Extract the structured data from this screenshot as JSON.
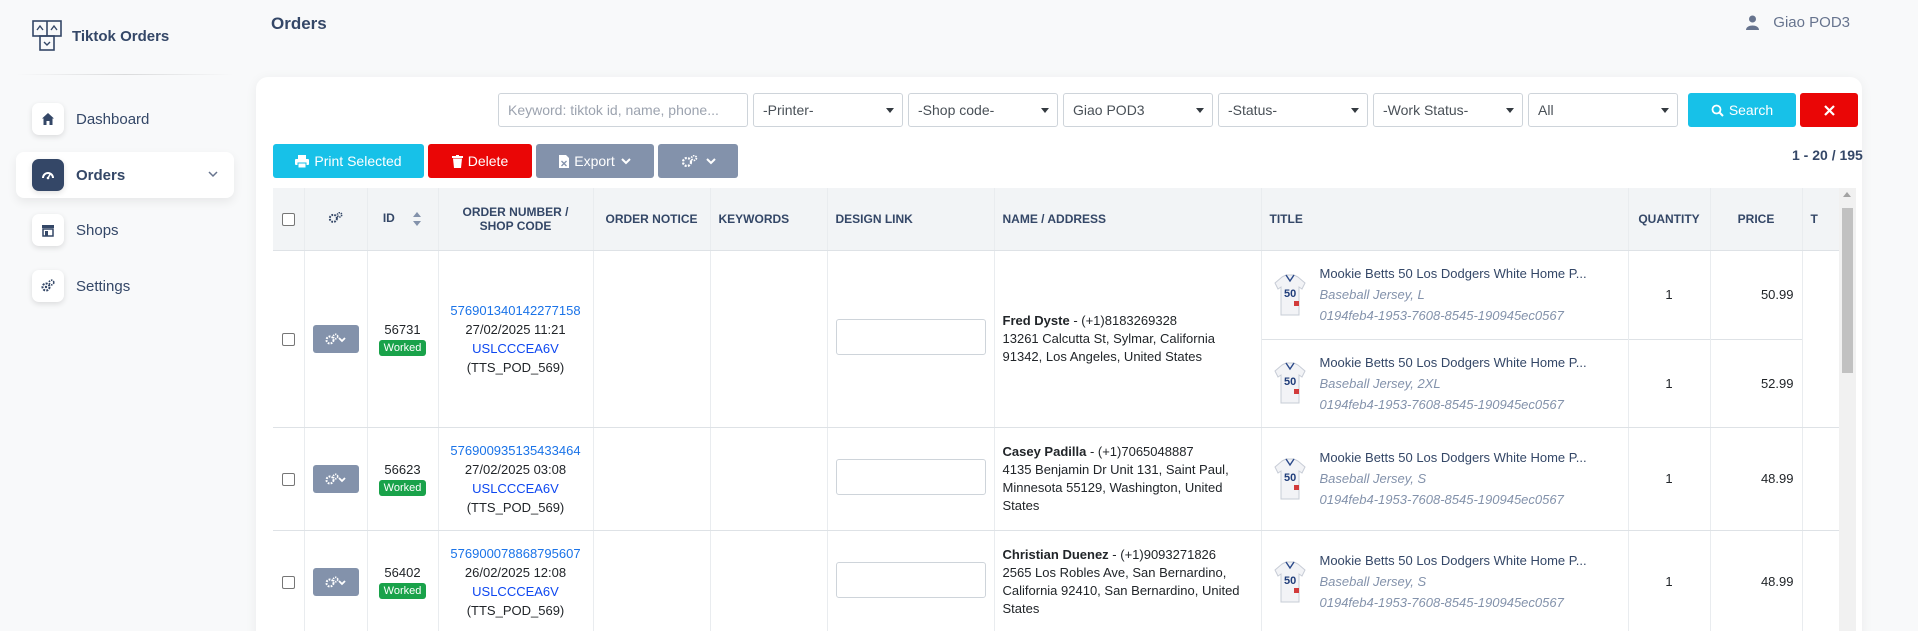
{
  "app": {
    "brand": "Tiktok Orders",
    "page_title": "Orders",
    "user_name": "Giao POD3"
  },
  "sidebar": {
    "items": [
      {
        "label": "Dashboard",
        "icon": "home-icon"
      },
      {
        "label": "Orders",
        "icon": "dashboard-icon",
        "active": true
      },
      {
        "label": "Shops",
        "icon": "shop-icon"
      },
      {
        "label": "Settings",
        "icon": "gears-icon"
      }
    ]
  },
  "filters": {
    "keyword_placeholder": "Keyword: tiktok id, name, phone...",
    "printer": "-Printer-",
    "shop_code": "-Shop code-",
    "seller": "Giao POD3",
    "status": "-Status-",
    "work_status": "-Work Status-",
    "all": "All",
    "search_label": "Search"
  },
  "toolbar": {
    "print_selected": "Print Selected",
    "delete": "Delete",
    "export": "Export"
  },
  "pagination": "1 - 20 / 195",
  "table": {
    "headers": {
      "id": "ID",
      "order_number": "ORDER NUMBER /",
      "shop_code": "SHOP CODE",
      "order_notice": "ORDER NOTICE",
      "keywords": "KEYWORDS",
      "design_link": "DESIGN LINK",
      "name_address": "NAME / ADDRESS",
      "title": "TITLE",
      "quantity": "QUANTITY",
      "price": "PRICE",
      "total": "T"
    },
    "rows": [
      {
        "id": "56731",
        "status": "Worked",
        "order_number": "576901340142277158",
        "date": "27/02/2025 11:21",
        "shop_code": "USLCCCEA6V",
        "shop_name": "(TTS_POD_569)",
        "name": "Fred Dyste",
        "phone": " - (+1)8183269328",
        "address": "13261 Calcutta St, Sylmar, California 91342, Los Angeles, United States",
        "items": [
          {
            "name": "Mookie Betts 50 Los Dodgers White Home P...",
            "variant": "Baseball Jersey, L",
            "sku": "0194feb4-1953-7608-8545-190945ec0567",
            "quantity": "1",
            "price": "50.99"
          },
          {
            "name": "Mookie Betts 50 Los Dodgers White Home P...",
            "variant": "Baseball Jersey, 2XL",
            "sku": "0194feb4-1953-7608-8545-190945ec0567",
            "quantity": "1",
            "price": "52.99"
          }
        ]
      },
      {
        "id": "56623",
        "status": "Worked",
        "order_number": "576900935135433464",
        "date": "27/02/2025 03:08",
        "shop_code": "USLCCCEA6V",
        "shop_name": "(TTS_POD_569)",
        "name": "Casey Padilla",
        "phone": " - (+1)7065048887",
        "address": "4135 Benjamin Dr Unit 131, Saint Paul, Minnesota 55129, Washington, United States",
        "items": [
          {
            "name": "Mookie Betts 50 Los Dodgers White Home P...",
            "variant": "Baseball Jersey, S",
            "sku": "0194feb4-1953-7608-8545-190945ec0567",
            "quantity": "1",
            "price": "48.99"
          }
        ]
      },
      {
        "id": "56402",
        "status": "Worked",
        "order_number": "576900078868795607",
        "date": "26/02/2025 12:08",
        "shop_code": "USLCCCEA6V",
        "shop_name": "(TTS_POD_569)",
        "name": "Christian Duenez",
        "phone": " - (+1)9093271826",
        "address": "2565 Los Robles Ave, San Bernardino, California 92410, San Bernardino, United States",
        "items": [
          {
            "name": "Mookie Betts 50 Los Dodgers White Home P...",
            "variant": "Baseball Jersey, S",
            "sku": "0194feb4-1953-7608-8545-190945ec0567",
            "quantity": "1",
            "price": "48.99"
          }
        ]
      }
    ]
  }
}
